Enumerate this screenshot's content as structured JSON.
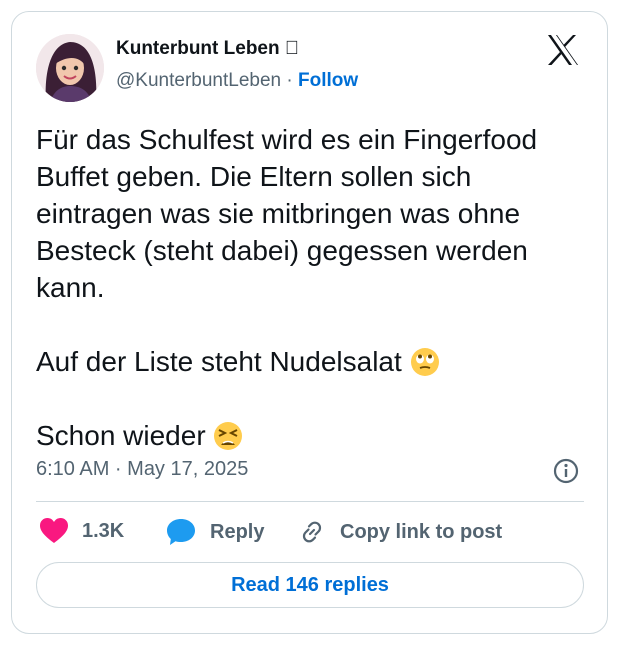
{
  "author": {
    "name": "Kunterbunt Leben \u0000",
    "handle": "@KunterbuntLeben",
    "separator": "·",
    "follow_label": "Follow"
  },
  "post": {
    "paragraph_1": "Für das Schulfest wird es ein Fingerfood\nBuffet geben. Die Eltern sollen sich\neintragen was sie mitbringen was ohne\nBesteck (steht dabei) gegessen werden\nkann.",
    "paragraph_2": "Auf der Liste steht Nudelsalat",
    "paragraph_3": "Schon wieder",
    "emoji_2": "eye-roll-emoji",
    "emoji_3": "tired-face-emoji"
  },
  "meta": {
    "timestamp": "6:10 AM · May 17, 2025"
  },
  "actions": {
    "likes": "1.3K",
    "reply_label": "Reply",
    "copy_label": "Copy link to post"
  },
  "footer": {
    "read_replies_label": "Read 146 replies"
  },
  "colors": {
    "link_blue": "#006fd6",
    "heart": "#f91880",
    "reply_bubble": "#1d9bf0",
    "muted": "#536471",
    "border": "#cfd9de"
  }
}
